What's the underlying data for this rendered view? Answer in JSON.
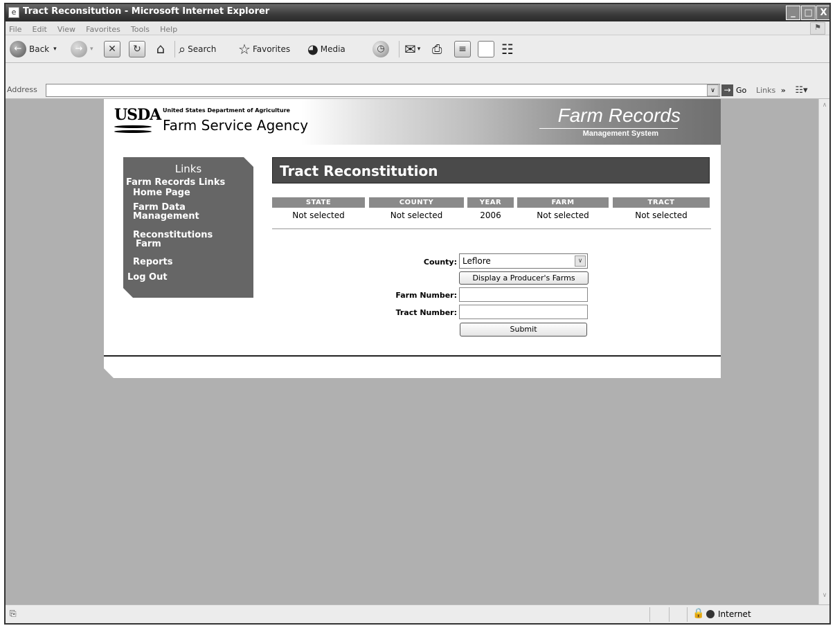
{
  "window": {
    "title": "Tract Reconsitution - Microsoft Internet Explorer",
    "minimize": "_",
    "maximize": "□",
    "close": "X"
  },
  "menu": [
    "File",
    "Edit",
    "View",
    "Favorites",
    "Tools",
    "Help"
  ],
  "toolbar": {
    "back": "Back",
    "search": "Search",
    "favorites": "Favorites",
    "media": "Media"
  },
  "address": {
    "label": "Address",
    "value": "",
    "go": "Go",
    "links": "Links"
  },
  "banner": {
    "logo_text": "USDA",
    "dept": "United States Department of Agriculture",
    "agency": "Farm Service Agency",
    "system_title": "Farm Records",
    "system_sub": "Management System"
  },
  "links": {
    "heading": "Links",
    "items": [
      "Farm Records Links",
      "Home Page",
      "Farm Data",
      "Management",
      "Reconstitutions",
      "Farm",
      "Reports",
      "Log Out"
    ]
  },
  "main": {
    "title": "Tract Reconstitution",
    "headers": [
      "STATE",
      "COUNTY",
      "YEAR",
      "FARM",
      "TRACT"
    ],
    "values": [
      "Not selected",
      "Not selected",
      "2006",
      "Not selected",
      "Not selected"
    ]
  },
  "form": {
    "county_label": "County:",
    "county_value": "Leflore",
    "display_button": "Display a Producer's Farms",
    "farm_label": "Farm Number:",
    "farm_value": "",
    "tract_label": "Tract Number:",
    "tract_value": "",
    "submit": "Submit"
  },
  "status": {
    "zone": "Internet"
  }
}
